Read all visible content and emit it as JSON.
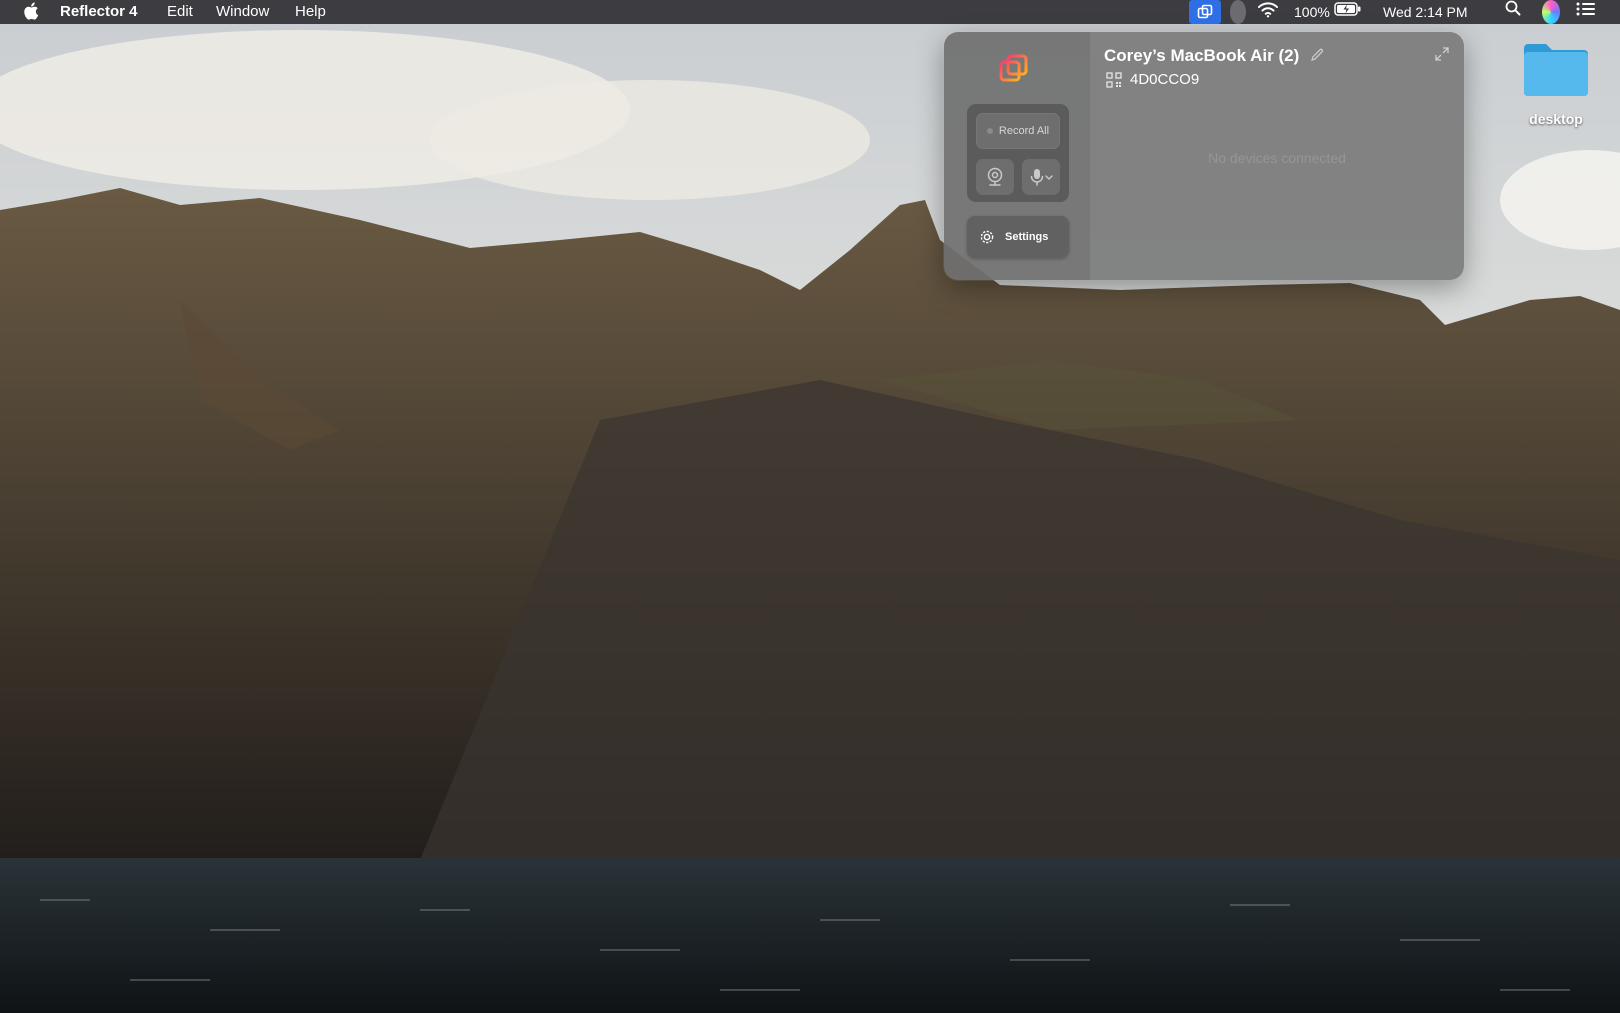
{
  "menubar": {
    "app_name": "Reflector 4",
    "menus": [
      "Edit",
      "Window",
      "Help"
    ],
    "battery_percent": "100%",
    "clock": "Wed 2:14 PM",
    "icons": [
      "apple-icon",
      "reflector-status-icon",
      "notification-dot-icon",
      "wifi-icon",
      "battery-charging-icon",
      "spotlight-search-icon",
      "siri-icon",
      "control-center-icon"
    ]
  },
  "desktop": {
    "folder_label": "desktop"
  },
  "panel": {
    "device_name": "Corey’s MacBook Air (2)",
    "connection_code": "4D0CCO9",
    "record_all_label": "Record All",
    "settings_label": "Settings",
    "empty_message": "No devices connected",
    "icons": [
      "reflector-logo-icon",
      "webcam-icon",
      "microphone-icon",
      "gear-icon",
      "pencil-edit-icon",
      "expand-icon",
      "qr-code-icon"
    ]
  },
  "colors": {
    "accent": "#2e6fe6",
    "logo_start": "#ff3b6b",
    "logo_end": "#ffb020"
  }
}
